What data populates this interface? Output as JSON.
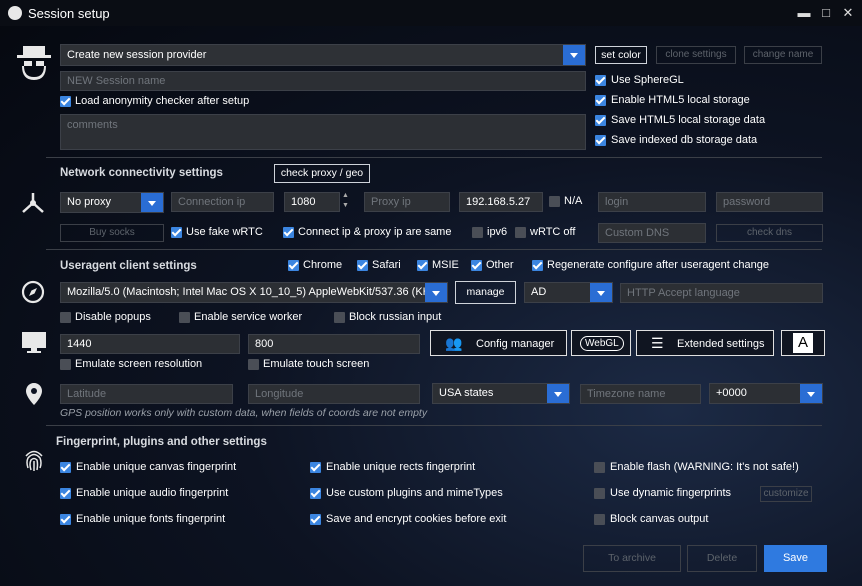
{
  "window": {
    "title": "Session setup",
    "minimize": "▬",
    "maximize": "□",
    "close": "✕"
  },
  "provider": {
    "select": "Create new session provider",
    "set_color": "set color",
    "clone_settings": "clone settings",
    "change_name": "change name",
    "session_name_placeholder": "NEW Session name",
    "load_checker": "Load anonymity checker after setup",
    "comments_placeholder": "comments"
  },
  "browser_opts": {
    "use_spheregl": "Use SphereGL",
    "enable_html5": "Enable HTML5 local storage",
    "save_html5": "Save HTML5 local storage data",
    "save_indexed": "Save indexed db storage data"
  },
  "network": {
    "heading": "Network connectivity settings",
    "check_proxy": "check proxy / geo",
    "proxy_type": "No proxy",
    "connection_ip_ph": "Connection ip",
    "port": "1080",
    "proxy_ip_ph": "Proxy ip",
    "ip_value": "192.168.5.27",
    "na": "N/A",
    "login_ph": "login",
    "password_ph": "password",
    "buy_socks": "Buy socks",
    "fake_webrtc": "Use fake wRTC",
    "connect_same": "Connect ip & proxy ip are same",
    "ipv6": "ipv6",
    "wrtc_off": "wRTC off",
    "custom_dns_ph": "Custom DNS",
    "check_dns": "check dns"
  },
  "useragent": {
    "heading": "Useragent client settings",
    "chrome": "Chrome",
    "safari": "Safari",
    "msie": "MSIE",
    "other": "Other",
    "regen": "Regenerate configure after useragent change",
    "ua_value": "Mozilla/5.0 (Macintosh; Intel Mac OS X 10_10_5) AppleWebKit/537.36 (KHTML",
    "manage": "manage",
    "lang": "AD",
    "accept_lang_ph": "HTTP Accept language",
    "disable_popups": "Disable popups",
    "enable_sw": "Enable service worker",
    "block_russian": "Block russian input"
  },
  "screen": {
    "width": "1440",
    "height": "800",
    "config_manager": "Config manager",
    "webgl": "WebGL",
    "extended": "Extended settings",
    "font_btn": "A",
    "emulate_res": "Emulate screen resolution",
    "emulate_touch": "Emulate touch screen"
  },
  "geo": {
    "lat_ph": "Latitude",
    "lon_ph": "Longitude",
    "states": "USA states",
    "timezone_ph": "Timezone name",
    "offset": "+0000",
    "note": "GPS position works only with custom data, when fields of coords are not empty"
  },
  "fingerprint": {
    "heading": "Fingerprint, plugins and other settings",
    "canvas": "Enable unique canvas fingerprint",
    "audio": "Enable unique audio fingerprint",
    "fonts": "Enable unique fonts fingerprint",
    "rects": "Enable unique rects fingerprint",
    "plugins": "Use custom plugins and mimeTypes",
    "cookies": "Save and encrypt cookies before exit",
    "flash": "Enable flash (WARNING: It's not safe!)",
    "dynamic": "Use dynamic fingerprints",
    "customize": "customize",
    "block_canvas": "Block canvas output"
  },
  "footer": {
    "archive": "To archive",
    "delete": "Delete",
    "save": "Save"
  },
  "colors": {
    "accent": "#2a6dd4",
    "checkbox": "#3b85e0"
  }
}
